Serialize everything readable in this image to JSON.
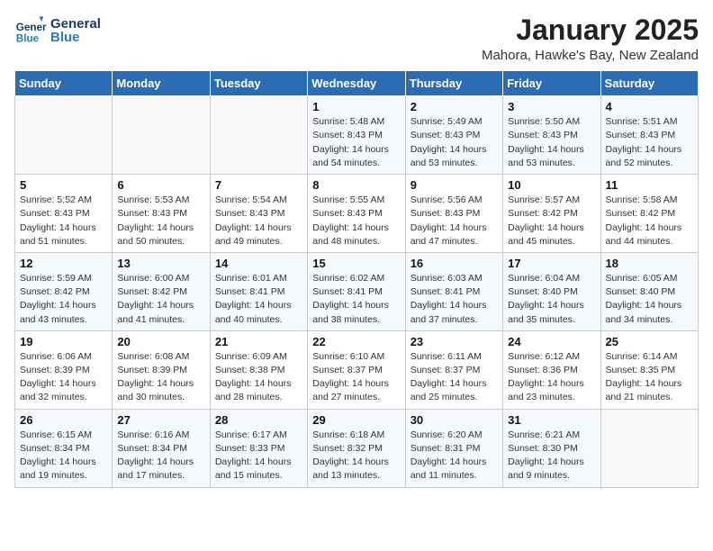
{
  "logo": {
    "line1": "General",
    "line2": "Blue"
  },
  "title": "January 2025",
  "subtitle": "Mahora, Hawke's Bay, New Zealand",
  "days_of_week": [
    "Sunday",
    "Monday",
    "Tuesday",
    "Wednesday",
    "Thursday",
    "Friday",
    "Saturday"
  ],
  "weeks": [
    [
      {
        "day": "",
        "info": ""
      },
      {
        "day": "",
        "info": ""
      },
      {
        "day": "",
        "info": ""
      },
      {
        "day": "1",
        "info": "Sunrise: 5:48 AM\nSunset: 8:43 PM\nDaylight: 14 hours\nand 54 minutes."
      },
      {
        "day": "2",
        "info": "Sunrise: 5:49 AM\nSunset: 8:43 PM\nDaylight: 14 hours\nand 53 minutes."
      },
      {
        "day": "3",
        "info": "Sunrise: 5:50 AM\nSunset: 8:43 PM\nDaylight: 14 hours\nand 53 minutes."
      },
      {
        "day": "4",
        "info": "Sunrise: 5:51 AM\nSunset: 8:43 PM\nDaylight: 14 hours\nand 52 minutes."
      }
    ],
    [
      {
        "day": "5",
        "info": "Sunrise: 5:52 AM\nSunset: 8:43 PM\nDaylight: 14 hours\nand 51 minutes."
      },
      {
        "day": "6",
        "info": "Sunrise: 5:53 AM\nSunset: 8:43 PM\nDaylight: 14 hours\nand 50 minutes."
      },
      {
        "day": "7",
        "info": "Sunrise: 5:54 AM\nSunset: 8:43 PM\nDaylight: 14 hours\nand 49 minutes."
      },
      {
        "day": "8",
        "info": "Sunrise: 5:55 AM\nSunset: 8:43 PM\nDaylight: 14 hours\nand 48 minutes."
      },
      {
        "day": "9",
        "info": "Sunrise: 5:56 AM\nSunset: 8:43 PM\nDaylight: 14 hours\nand 47 minutes."
      },
      {
        "day": "10",
        "info": "Sunrise: 5:57 AM\nSunset: 8:42 PM\nDaylight: 14 hours\nand 45 minutes."
      },
      {
        "day": "11",
        "info": "Sunrise: 5:58 AM\nSunset: 8:42 PM\nDaylight: 14 hours\nand 44 minutes."
      }
    ],
    [
      {
        "day": "12",
        "info": "Sunrise: 5:59 AM\nSunset: 8:42 PM\nDaylight: 14 hours\nand 43 minutes."
      },
      {
        "day": "13",
        "info": "Sunrise: 6:00 AM\nSunset: 8:42 PM\nDaylight: 14 hours\nand 41 minutes."
      },
      {
        "day": "14",
        "info": "Sunrise: 6:01 AM\nSunset: 8:41 PM\nDaylight: 14 hours\nand 40 minutes."
      },
      {
        "day": "15",
        "info": "Sunrise: 6:02 AM\nSunset: 8:41 PM\nDaylight: 14 hours\nand 38 minutes."
      },
      {
        "day": "16",
        "info": "Sunrise: 6:03 AM\nSunset: 8:41 PM\nDaylight: 14 hours\nand 37 minutes."
      },
      {
        "day": "17",
        "info": "Sunrise: 6:04 AM\nSunset: 8:40 PM\nDaylight: 14 hours\nand 35 minutes."
      },
      {
        "day": "18",
        "info": "Sunrise: 6:05 AM\nSunset: 8:40 PM\nDaylight: 14 hours\nand 34 minutes."
      }
    ],
    [
      {
        "day": "19",
        "info": "Sunrise: 6:06 AM\nSunset: 8:39 PM\nDaylight: 14 hours\nand 32 minutes."
      },
      {
        "day": "20",
        "info": "Sunrise: 6:08 AM\nSunset: 8:39 PM\nDaylight: 14 hours\nand 30 minutes."
      },
      {
        "day": "21",
        "info": "Sunrise: 6:09 AM\nSunset: 8:38 PM\nDaylight: 14 hours\nand 28 minutes."
      },
      {
        "day": "22",
        "info": "Sunrise: 6:10 AM\nSunset: 8:37 PM\nDaylight: 14 hours\nand 27 minutes."
      },
      {
        "day": "23",
        "info": "Sunrise: 6:11 AM\nSunset: 8:37 PM\nDaylight: 14 hours\nand 25 minutes."
      },
      {
        "day": "24",
        "info": "Sunrise: 6:12 AM\nSunset: 8:36 PM\nDaylight: 14 hours\nand 23 minutes."
      },
      {
        "day": "25",
        "info": "Sunrise: 6:14 AM\nSunset: 8:35 PM\nDaylight: 14 hours\nand 21 minutes."
      }
    ],
    [
      {
        "day": "26",
        "info": "Sunrise: 6:15 AM\nSunset: 8:34 PM\nDaylight: 14 hours\nand 19 minutes."
      },
      {
        "day": "27",
        "info": "Sunrise: 6:16 AM\nSunset: 8:34 PM\nDaylight: 14 hours\nand 17 minutes."
      },
      {
        "day": "28",
        "info": "Sunrise: 6:17 AM\nSunset: 8:33 PM\nDaylight: 14 hours\nand 15 minutes."
      },
      {
        "day": "29",
        "info": "Sunrise: 6:18 AM\nSunset: 8:32 PM\nDaylight: 14 hours\nand 13 minutes."
      },
      {
        "day": "30",
        "info": "Sunrise: 6:20 AM\nSunset: 8:31 PM\nDaylight: 14 hours\nand 11 minutes."
      },
      {
        "day": "31",
        "info": "Sunrise: 6:21 AM\nSunset: 8:30 PM\nDaylight: 14 hours\nand 9 minutes."
      },
      {
        "day": "",
        "info": ""
      }
    ]
  ]
}
